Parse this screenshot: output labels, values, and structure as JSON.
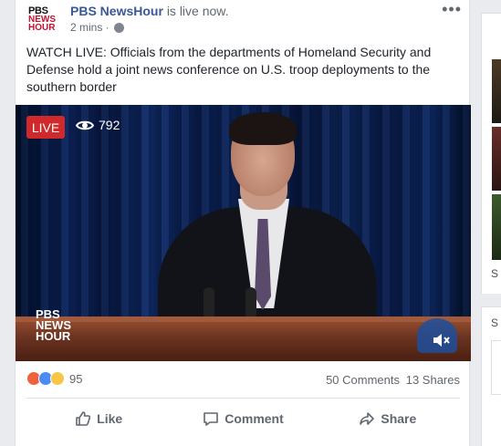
{
  "post": {
    "page_name": "PBS NewsHour",
    "status_suffix": "is live now.",
    "time": "2 mins ·",
    "more_label": "•••",
    "text": "WATCH LIVE: Officials from the departments of Homeland Security and Defense hold a joint news conference on U.S. troop deployments to the southern border",
    "avatar_lines": [
      "PBS",
      "NEWS",
      "HOUR"
    ]
  },
  "video": {
    "live_label": "LIVE",
    "viewer_count": "792",
    "logo_lines": [
      "PBS",
      "NEWS",
      "HOUR"
    ]
  },
  "stats": {
    "reaction_count": "95",
    "comments": "50 Comments",
    "shares": "13 Shares"
  },
  "actions": {
    "like": "Like",
    "comment": "Comment",
    "share": "Share"
  },
  "right_column": {
    "label_1": "S",
    "label_2": "S"
  },
  "colors": {
    "brand_blue": "#385898",
    "live_red": "#d0292b"
  }
}
